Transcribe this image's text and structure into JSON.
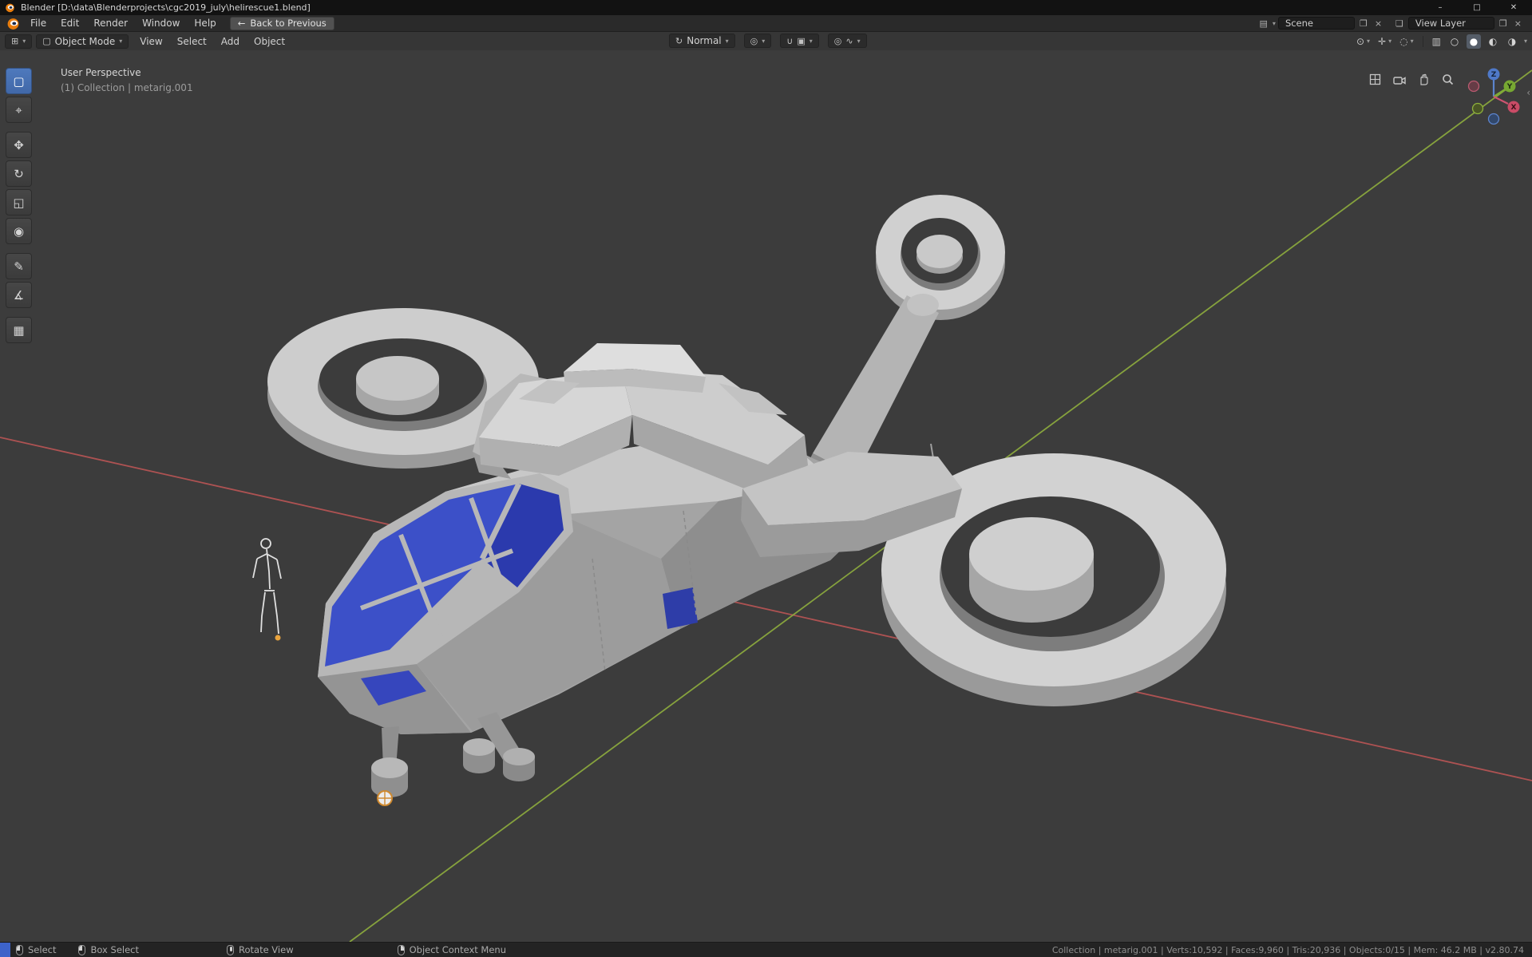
{
  "titlebar": {
    "title": "Blender [D:\\data\\Blenderprojects\\cgc2019_july\\helirescue1.blend]",
    "minimize_icon": "–",
    "maximize_icon": "□",
    "close_icon": "✕"
  },
  "menubar": {
    "menus": [
      {
        "label": "File"
      },
      {
        "label": "Edit"
      },
      {
        "label": "Render"
      },
      {
        "label": "Window"
      },
      {
        "label": "Help"
      }
    ],
    "back_button": {
      "icon": "←",
      "label": "Back to Previous"
    },
    "scene_selector": {
      "value": "Scene"
    },
    "view_layer_selector": {
      "value": "View Layer"
    }
  },
  "tool_header": {
    "mode_dropdown": {
      "value": "Object Mode"
    },
    "menus": [
      {
        "label": "View"
      },
      {
        "label": "Select"
      },
      {
        "label": "Add"
      },
      {
        "label": "Object"
      }
    ],
    "orientation_dropdown": {
      "value": "Normal"
    }
  },
  "toolbar": {
    "tools": [
      {
        "name": "select-box",
        "glyph": "▢",
        "active": true
      },
      {
        "name": "cursor",
        "glyph": "⌖",
        "active": false
      },
      {
        "name": "move",
        "glyph": "✥",
        "active": false
      },
      {
        "name": "rotate",
        "glyph": "↻",
        "active": false
      },
      {
        "name": "scale",
        "glyph": "◱",
        "active": false
      },
      {
        "name": "transform",
        "glyph": "◉",
        "active": false
      },
      {
        "name": "annotate",
        "glyph": "✎",
        "active": false
      },
      {
        "name": "measure",
        "glyph": "∡",
        "active": false
      },
      {
        "name": "add-cube",
        "glyph": "▦",
        "active": false
      }
    ]
  },
  "viewport": {
    "perspective_label": "User Perspective",
    "collection_label": "(1) Collection | metarig.001",
    "axis_gizmo": {
      "x_label": "X",
      "y_label": "Y",
      "z_label": "Z"
    }
  },
  "scene_3d": {
    "object_description": "gray sci-fi rescue helicopter with twin ducted rotors, tail rotor ring, blue canopy, plus metarig armature figure",
    "body_color": "#a9a9a9",
    "canopy_color": "#3c50c8",
    "axis_x_color": "#c25757",
    "axis_y_color": "#8fae3e"
  },
  "statusbar": {
    "hints": [
      {
        "label": "Select"
      },
      {
        "label": "Box Select"
      },
      {
        "label": "Rotate View"
      },
      {
        "label": "Object Context Menu"
      }
    ],
    "info": "Collection | metarig.001 | Verts:10,592 | Faces:9,960 | Tris:20,936 | Objects:0/15 | Mem: 46.2 MB | v2.80.74"
  },
  "icons": {
    "dropdown": "▾",
    "editor_type": "⊞",
    "mode": "▢",
    "orientation": "↻",
    "pivot": "◎",
    "snap_magnet": "∪",
    "snap_target": "▣",
    "proportional": "◎",
    "falloff": "∿",
    "visibility": "⊙",
    "gizmos_toggle": "✛",
    "overlays": "◌",
    "xray": "▥",
    "shading_wireframe": "○",
    "shading_solid": "●",
    "shading_material": "◐",
    "shading_rendered": "◑",
    "scene": "▤",
    "view_layer": "❏",
    "duplicate": "❐",
    "close_small": "×",
    "sidebar_toggle": "‹"
  }
}
